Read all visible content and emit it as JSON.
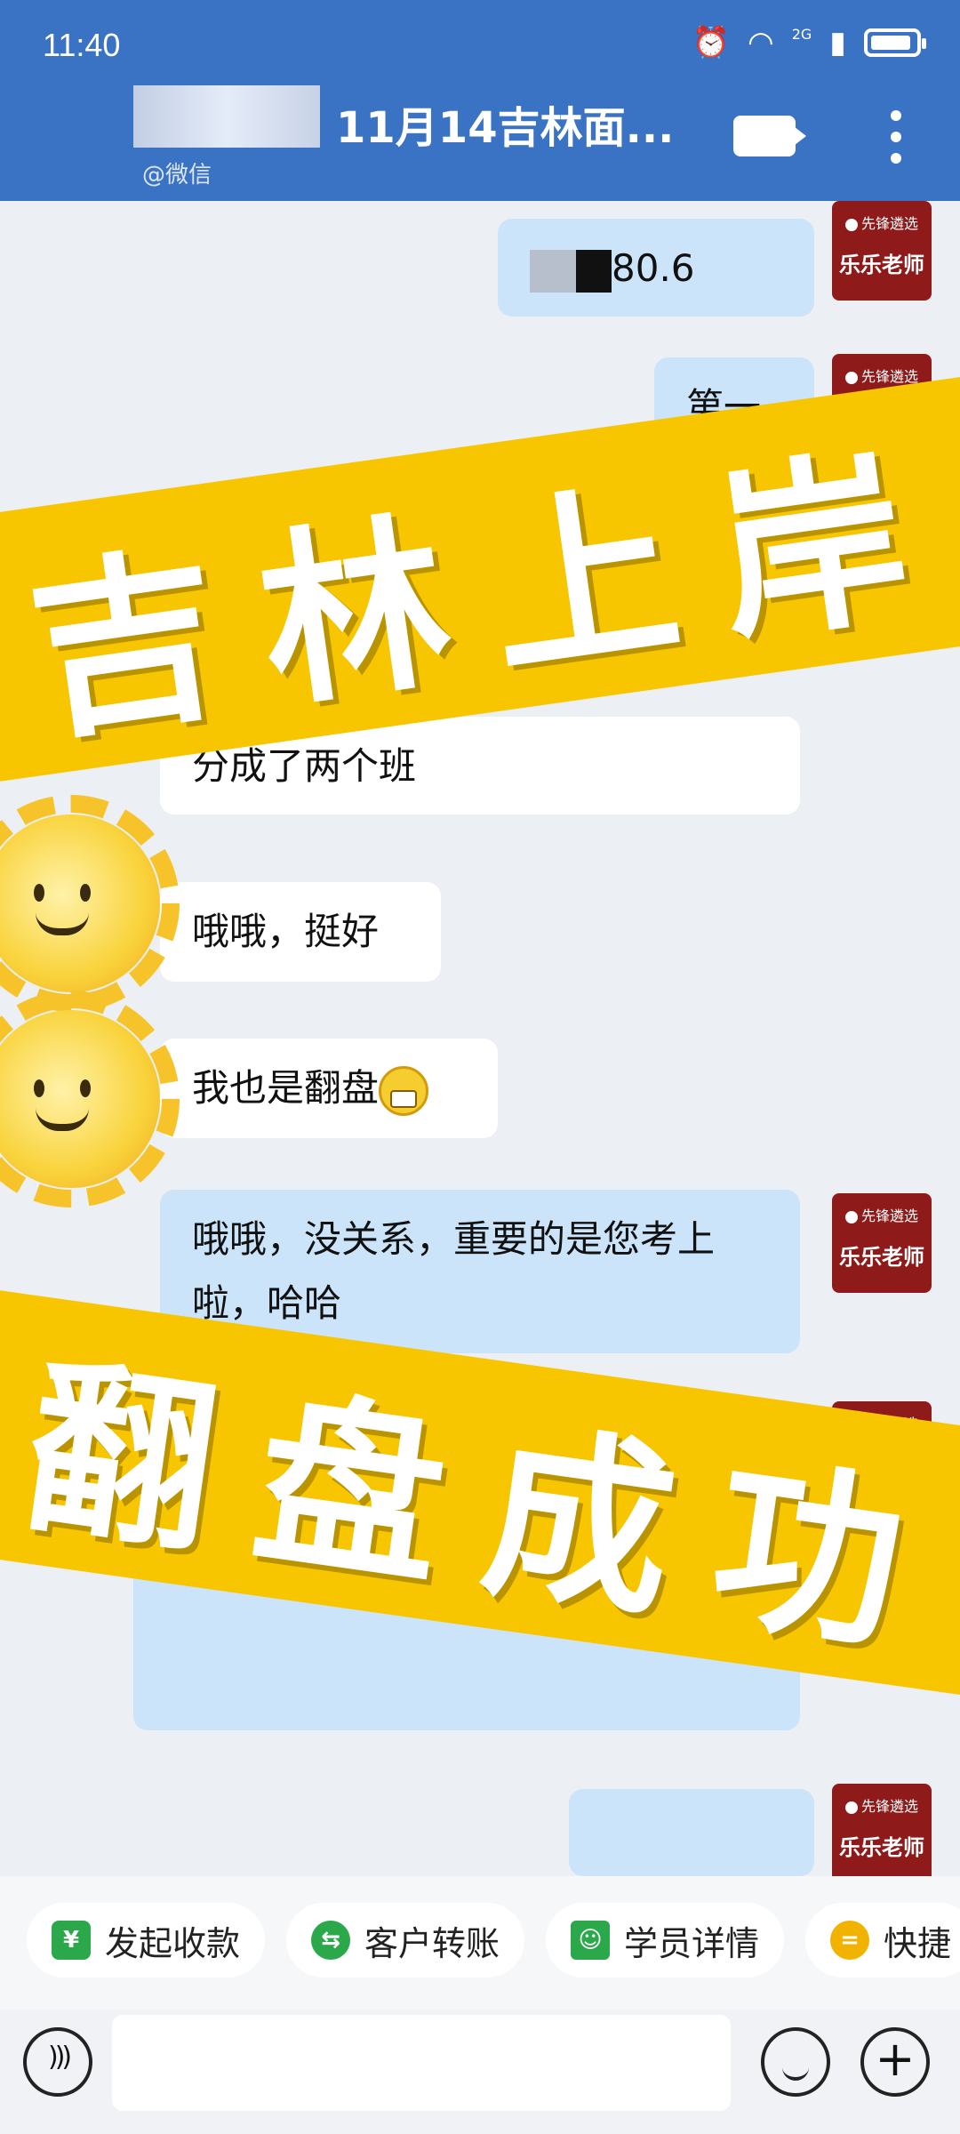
{
  "status_bar": {
    "time": "11:40",
    "network": "2G"
  },
  "header": {
    "title": "11月14吉林面...",
    "subtitle": "@微信"
  },
  "teacher": {
    "name": "乐乐老师",
    "brand": "先锋遴选"
  },
  "messages": [
    {
      "side": "right",
      "text": "80.6"
    },
    {
      "side": "right",
      "text": "第一"
    },
    {
      "side": "left",
      "text": "分成了两个班"
    },
    {
      "side": "left",
      "text": "哦哦，挺好"
    },
    {
      "side": "left",
      "text": "我也是翻盘"
    },
    {
      "side": "right",
      "text": "哦哦，没关系，重要的是您考上啦，哈哈"
    }
  ],
  "banners": {
    "top": "吉林上岸",
    "bottom": "翻盘成功"
  },
  "quick_actions": [
    "发起收款",
    "客户转账",
    "学员详情",
    "快捷"
  ],
  "colors": {
    "header": "#3a72c4",
    "banner": "#f7c600",
    "avatar": "#8e1a1a",
    "bubble_right": "#cbe4fa"
  }
}
